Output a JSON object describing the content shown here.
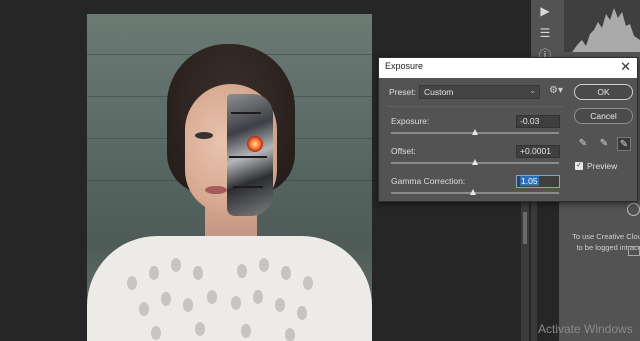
{
  "dialog": {
    "title": "Exposure",
    "close_icon": "close-icon",
    "preset_label": "Preset:",
    "preset_value": "Custom",
    "settings_icon": "gear-icon",
    "exposure_label": "Exposure:",
    "exposure_value": "-0.03",
    "exposure_slider_fraction": 0.5,
    "offset_label": "Offset:",
    "offset_value": "+0.0001",
    "offset_slider_fraction": 0.5,
    "gamma_label": "Gamma Correction:",
    "gamma_value": "1.05",
    "gamma_slider_fraction": 0.49,
    "ok_label": "OK",
    "cancel_label": "Cancel",
    "droppers": [
      "eyedropper-black-icon",
      "eyedropper-gray-icon",
      "eyedropper-white-icon"
    ],
    "preview_label": "Preview",
    "preview_checked": true
  },
  "side_panel": {
    "cc_message": "To use Creative Cloud to be logged int acc",
    "tool_icons": [
      "play-icon",
      "adjustments-icon",
      "info-icon"
    ]
  },
  "watermark": {
    "text": "Activate Windows"
  },
  "colors": {
    "app_bg": "#262626",
    "panel_bg": "#535353",
    "highlight": "#2f6fb8"
  }
}
